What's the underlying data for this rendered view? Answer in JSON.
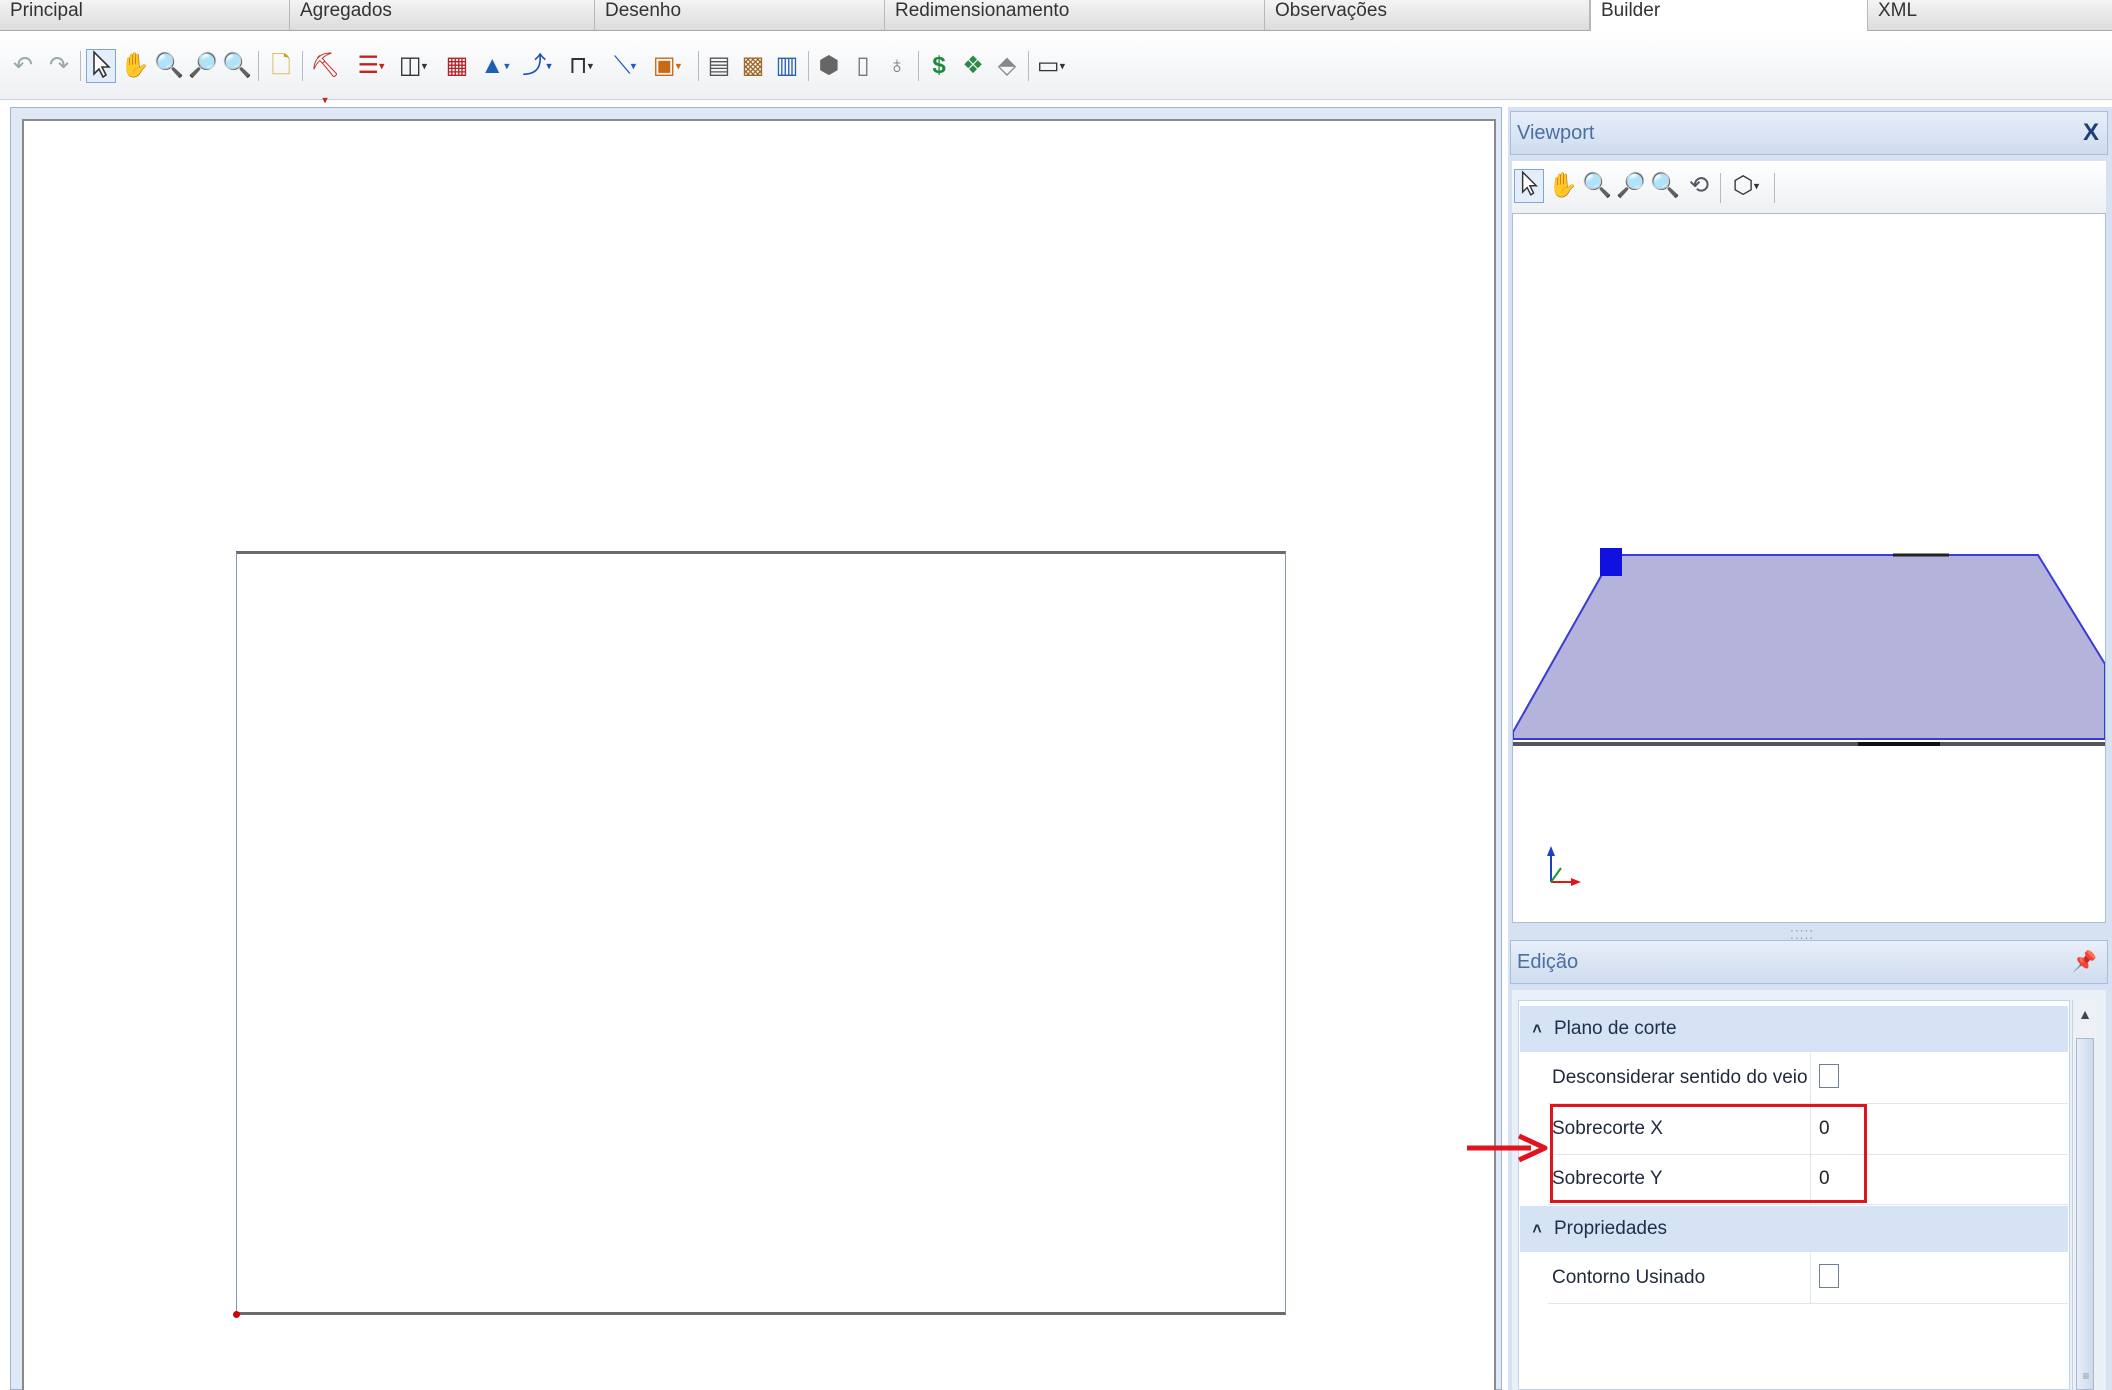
{
  "tabs": [
    {
      "label": "Principal",
      "active": false
    },
    {
      "label": "Agregados",
      "active": false
    },
    {
      "label": "Desenho",
      "active": false
    },
    {
      "label": "Redimensionamento",
      "active": false
    },
    {
      "label": "Observações",
      "active": false
    },
    {
      "label": "Builder",
      "active": true
    },
    {
      "label": "XML",
      "active": false
    }
  ],
  "toolbar_icons": [
    "undo-icon",
    "redo-icon",
    "select-pointer-icon",
    "pan-hand-icon",
    "zoom-realtime-icon",
    "zoom-window-icon",
    "zoom-extents-icon",
    "new-note-icon",
    "drill-tool-icon",
    "horizontal-split-icon",
    "vertical-split-icon",
    "material-icon",
    "paint-icon",
    "curve-icon",
    "frame-icon",
    "line-icon",
    "cube-insert-icon",
    "edit-icon",
    "grid-icon",
    "columns-icon",
    "box-3d-icon",
    "cabinet-icon",
    "money-bag-icon",
    "dollar-icon",
    "cash-icon",
    "eraser-icon",
    "layout-icon"
  ],
  "viewport": {
    "title": "Viewport",
    "close_label": "X",
    "icons": [
      "select-pointer-icon",
      "pan-hand-icon",
      "zoom-realtime-icon",
      "zoom-window-icon",
      "zoom-extents-icon",
      "orbit-icon",
      "view-cube-icon"
    ],
    "face_color": "#b3b3dc",
    "edge_color": "#3a3ad8",
    "handle_color": "#1010e0"
  },
  "edicao": {
    "title": "Edição",
    "categories": [
      {
        "label": "Plano de corte",
        "properties": [
          {
            "name": "Desconsiderar sentido do veio (...",
            "type": "checkbox",
            "checked": false
          },
          {
            "name": "Sobrecorte X",
            "type": "text",
            "value": "0"
          },
          {
            "name": "Sobrecorte Y",
            "type": "text",
            "value": "0"
          }
        ]
      },
      {
        "label": "Propriedades",
        "properties": [
          {
            "name": "Contorno Usinado",
            "type": "checkbox",
            "checked": false
          }
        ]
      }
    ]
  },
  "colors": {
    "annotation_red": "#e0141e",
    "panel_header_text": "#4b6ea3",
    "origin_dot": "#d40000"
  }
}
